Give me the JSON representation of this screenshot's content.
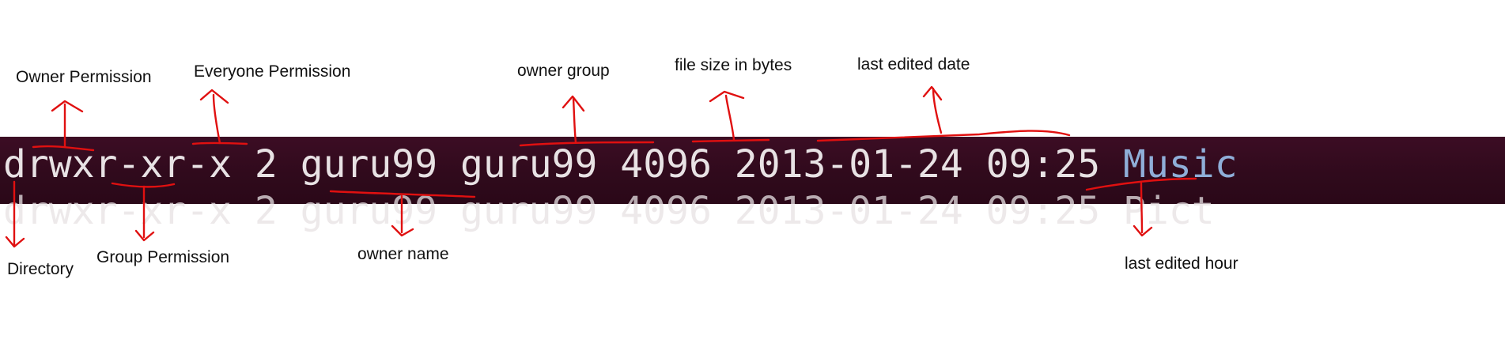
{
  "terminal": {
    "permissions": "drwxr-xr-x",
    "links": "2",
    "owner": "guru99",
    "group": "guru99",
    "size": "4096",
    "date": "2013-01-24",
    "time": "09:25",
    "name": "Music",
    "ghost_line": "drwxr-xr-x 2 guru99 guru99 4096 2013-01-24 09:25 Pict",
    "colors": {
      "background": "#300a1c",
      "text": "#e8e2e4",
      "directory": "#8faed8"
    }
  },
  "annotations": {
    "owner_permission": "Owner Permission",
    "everyone_permission": "Everyone Permission",
    "owner_group": "owner group",
    "file_size": "file size in bytes",
    "last_edited_date": "last edited date",
    "directory": "Directory",
    "group_permission": "Group Permission",
    "owner_name": "owner name",
    "last_edited_hour": "last edited hour",
    "color": "#e01010"
  }
}
